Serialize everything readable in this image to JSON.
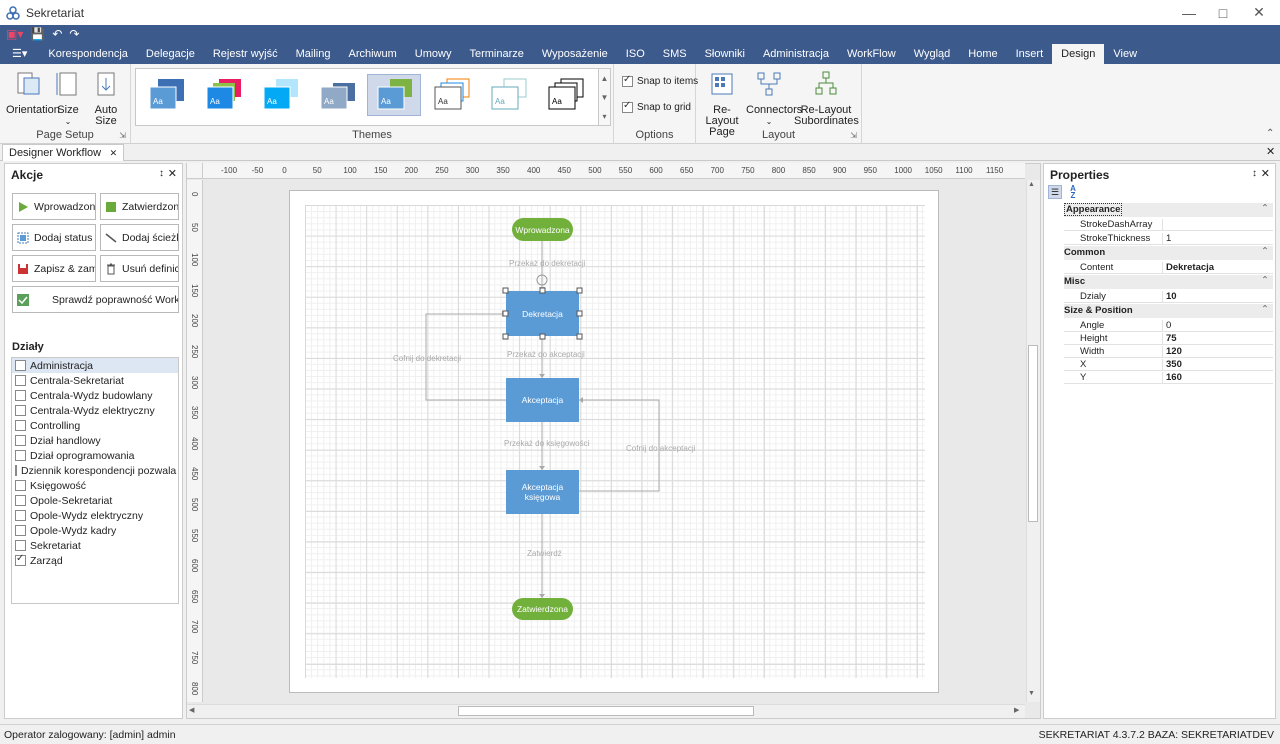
{
  "app": {
    "title": "Sekretariat"
  },
  "tabs": [
    "Korespondencja",
    "Delegacje",
    "Rejestr wyjść",
    "Mailing",
    "Archiwum",
    "Umowy",
    "Terminarze",
    "Wyposażenie",
    "ISO",
    "SMS",
    "Słowniki",
    "Administracja",
    "WorkFlow",
    "Wygląd",
    "Home",
    "Insert",
    "Design",
    "View"
  ],
  "active_tab": "Design",
  "ribbon": {
    "page_setup": {
      "label": "Page Setup",
      "orientation": "Orientation",
      "size": "Size",
      "auto_size": "Auto Size"
    },
    "themes": {
      "label": "Themes",
      "sample": "Aa"
    },
    "options": {
      "label": "Options",
      "snap_items": "Snap to items",
      "snap_grid": "Snap to grid"
    },
    "layout": {
      "label": "Layout",
      "relayout_page_1": "Re-Layout",
      "relayout_page_2": "Page",
      "connectors": "Connectors",
      "relayout_sub_1": "Re-Layout",
      "relayout_sub_2": "Subordinates"
    }
  },
  "doc_tab": "Designer Workflow",
  "left": {
    "title": "Akcje",
    "buttons": {
      "wprowadzona": "Wprowadzona",
      "zatwierdzona": "Zatwierdzona",
      "dodaj_status": "Dodaj status",
      "dodaj_sciezke": "Dodaj ścieżkę",
      "zapisz": "Zapisz & zamknij",
      "usun": "Usuń definicję",
      "sprawdz": "Sprawdź poprawność Workflow"
    },
    "dzialy_title": "Działy",
    "dzialy": [
      {
        "label": "Administracja",
        "checked": false
      },
      {
        "label": "Centrala-Sekretariat",
        "checked": false
      },
      {
        "label": "Centrala-Wydz budowlany",
        "checked": false
      },
      {
        "label": "Centrala-Wydz elektryczny",
        "checked": false
      },
      {
        "label": "Controlling",
        "checked": false
      },
      {
        "label": "Dział handlowy",
        "checked": false
      },
      {
        "label": "Dział oprogramowania",
        "checked": false
      },
      {
        "label": "Dziennik korespondencji pozwala na ev",
        "checked": false
      },
      {
        "label": "Księgowość",
        "checked": false
      },
      {
        "label": "Opole-Sekretariat",
        "checked": false
      },
      {
        "label": "Opole-Wydz elektryczny",
        "checked": false
      },
      {
        "label": "Opole-Wydz kadry",
        "checked": false
      },
      {
        "label": "Sekretariat",
        "checked": false
      },
      {
        "label": "Zarząd",
        "checked": true
      }
    ]
  },
  "ruler": {
    "h": [
      "-100",
      "-50",
      "0",
      "50",
      "100",
      "150",
      "200",
      "250",
      "300",
      "350",
      "400",
      "450",
      "500",
      "550",
      "600",
      "650",
      "700",
      "750",
      "800",
      "850",
      "900",
      "950",
      "1000",
      "1050",
      "1100",
      "1150"
    ],
    "v": [
      "0",
      "50",
      "100",
      "150",
      "200",
      "250",
      "300",
      "350",
      "400",
      "450",
      "500",
      "550",
      "600",
      "650",
      "700",
      "750",
      "800"
    ]
  },
  "diagram": {
    "nodes": {
      "wprowadzona": "Wprowadzona",
      "dekretacja": "Dekretacja",
      "akceptacja": "Akceptacja",
      "akc_ksiegowa": "Akceptacja księgowa",
      "zatwierdzona": "Zatwierdzona"
    },
    "connectors": {
      "c1": "Przekaż do dekretacji",
      "c2": "Przekaż do akceptacji",
      "c3": "Cofnij do dekretacji",
      "c4": "Przekaż do księgowości",
      "c5": "Cofnij do akceptacji",
      "c6": "Zatwierdź"
    }
  },
  "properties": {
    "title": "Properties",
    "categories": {
      "appearance": "Appearance",
      "common": "Common",
      "misc": "Misc",
      "size_position": "Size & Position"
    },
    "rows": {
      "stroke_dash": {
        "key": "StrokeDashArray",
        "value": ""
      },
      "stroke_thick": {
        "key": "StrokeThickness",
        "value": "1"
      },
      "content": {
        "key": "Content",
        "value": "Dekretacja"
      },
      "dzialy": {
        "key": "Dzialy",
        "value": "10"
      },
      "angle": {
        "key": "Angle",
        "value": "0"
      },
      "height": {
        "key": "Height",
        "value": "75"
      },
      "width": {
        "key": "Width",
        "value": "120"
      },
      "x": {
        "key": "X",
        "value": "350"
      },
      "y": {
        "key": "Y",
        "value": "160"
      }
    }
  },
  "status": {
    "left": "Operator zalogowany: [admin] admin",
    "right": "SEKRETARIAT 4.3.7.2 BAZA: SEKRETARIATDEV"
  },
  "colors": {
    "ribbon_bar": "#3c5a8c",
    "node_pill": "#72b03c",
    "node_rect": "#5b9bd5"
  }
}
